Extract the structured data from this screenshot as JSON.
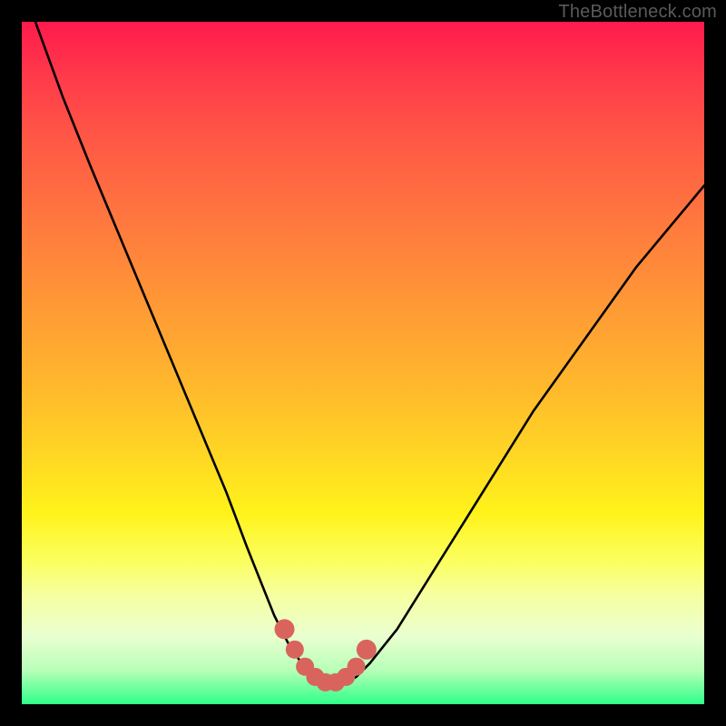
{
  "watermark": "TheBottleneck.com",
  "chart_data": {
    "type": "line",
    "title": "",
    "xlabel": "",
    "ylabel": "",
    "xlim": [
      0,
      100
    ],
    "ylim": [
      0,
      100
    ],
    "series": [
      {
        "name": "bottleneck-curve",
        "x": [
          2,
          6,
          10,
          15,
          20,
          25,
          30,
          33,
          35,
          37,
          39,
          41,
          43,
          45,
          47,
          49,
          51,
          55,
          60,
          65,
          70,
          75,
          80,
          85,
          90,
          95,
          100
        ],
        "y": [
          100,
          89,
          79,
          67,
          55,
          43,
          31,
          23,
          18,
          13,
          9,
          6,
          4,
          3,
          3,
          4,
          6,
          11,
          19,
          27,
          35,
          43,
          50,
          57,
          64,
          70,
          76
        ]
      },
      {
        "name": "highlight-dots",
        "x": [
          38.5,
          40,
          41.5,
          43,
          44.5,
          46,
          47.5,
          49,
          50.5
        ],
        "y": [
          11,
          8,
          5.5,
          4,
          3.2,
          3.2,
          4,
          5.5,
          8
        ]
      }
    ],
    "colors": {
      "curve": "#000000",
      "highlight": "#d9645e",
      "gradient_top": "#ff1a4d",
      "gradient_bottom": "#2fff8a"
    }
  }
}
